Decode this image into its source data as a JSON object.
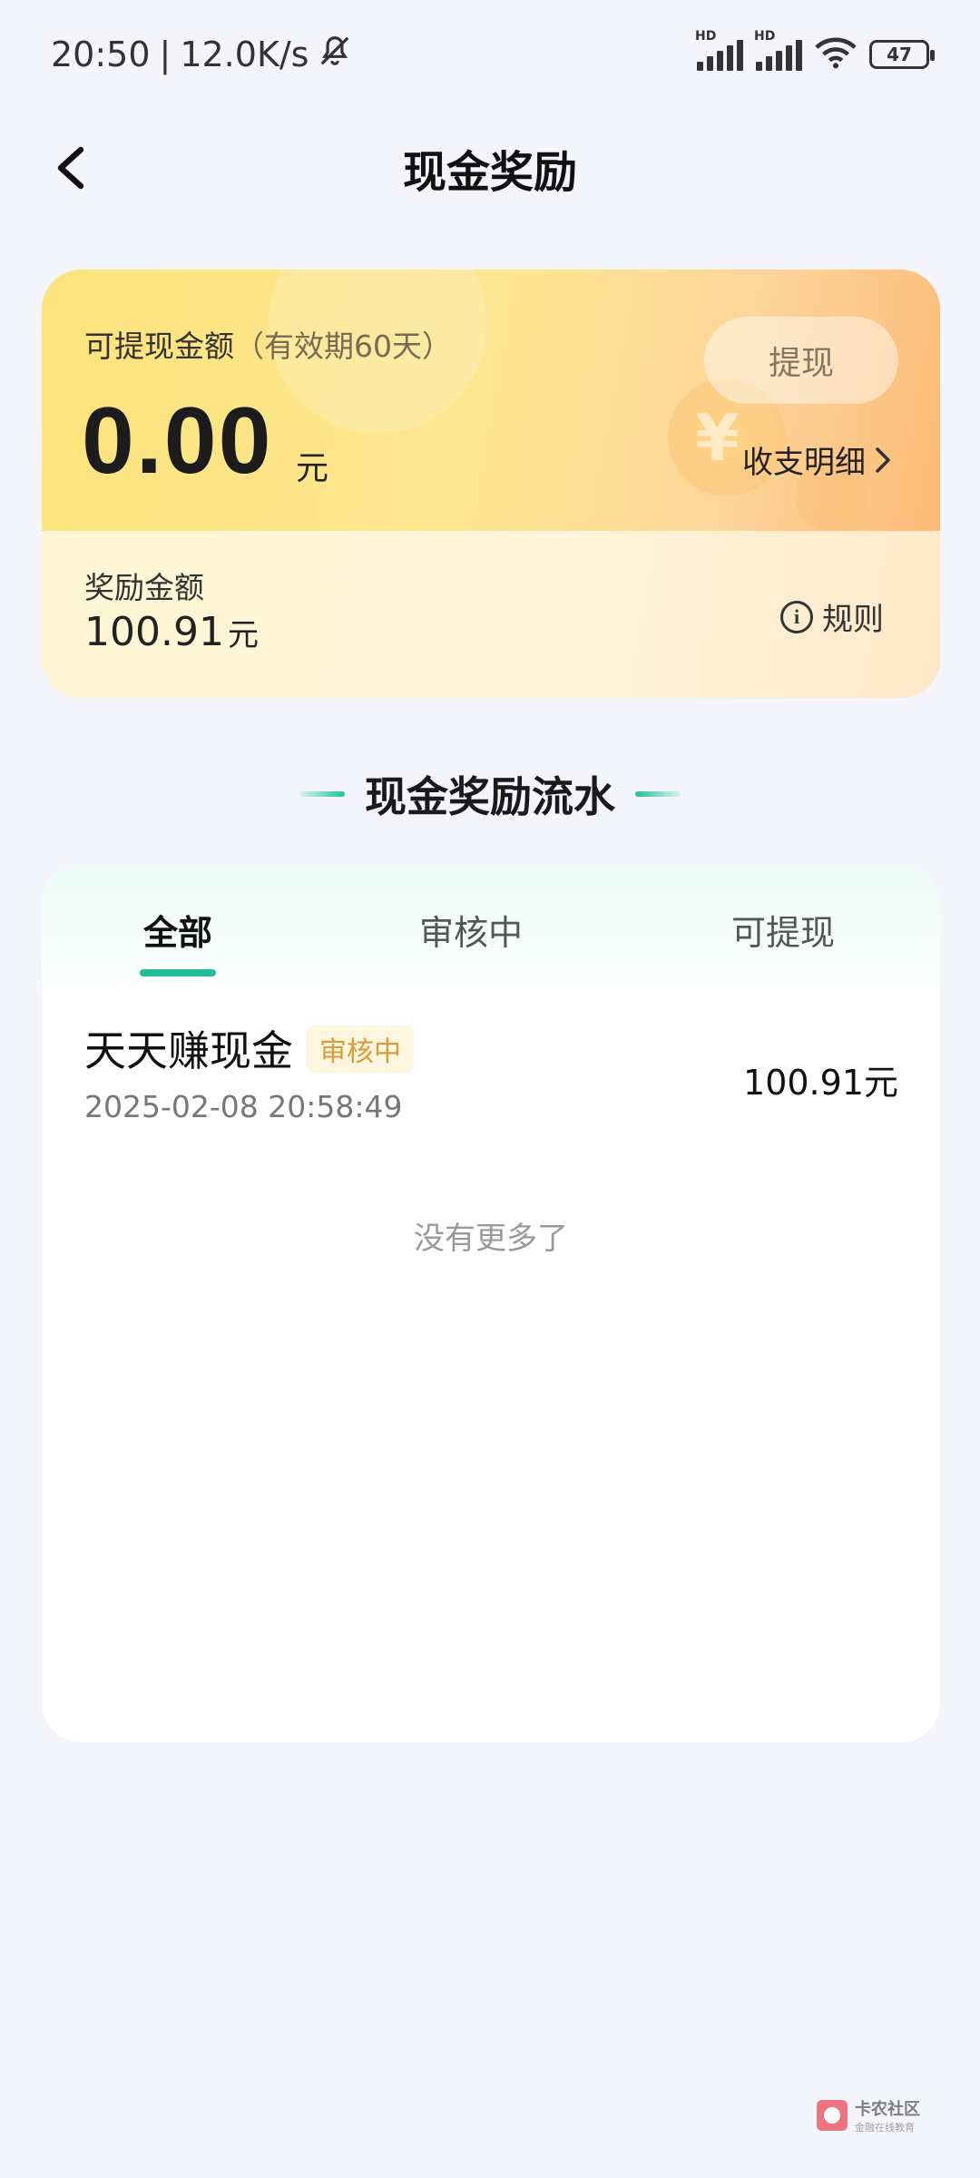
{
  "status_bar": {
    "time": "20:50",
    "separator": "|",
    "net_speed": "12.0K/s",
    "battery": "47"
  },
  "header": {
    "title": "现金奖励"
  },
  "cash_card": {
    "withdrawable_label": "可提现金额",
    "validity_note": "（有效期60天）",
    "withdraw_button": "提现",
    "amount": "0.00",
    "unit": "元",
    "details_link": "收支明细",
    "reward_label": "奖励金额",
    "reward_amount": "100.91",
    "reward_unit": "元",
    "rules_link": "规则"
  },
  "section": {
    "title": "现金奖励流水"
  },
  "tabs": [
    {
      "label": "全部",
      "active": true
    },
    {
      "label": "审核中",
      "active": false
    },
    {
      "label": "可提现",
      "active": false
    }
  ],
  "records": [
    {
      "title": "天天赚现金",
      "badge": "审核中",
      "time": "2025-02-08 20:58:49",
      "amount": "100.91元"
    }
  ],
  "empty_hint": "没有更多了",
  "watermark": {
    "title": "卡农社区",
    "subtitle": "金融在线教育"
  }
}
